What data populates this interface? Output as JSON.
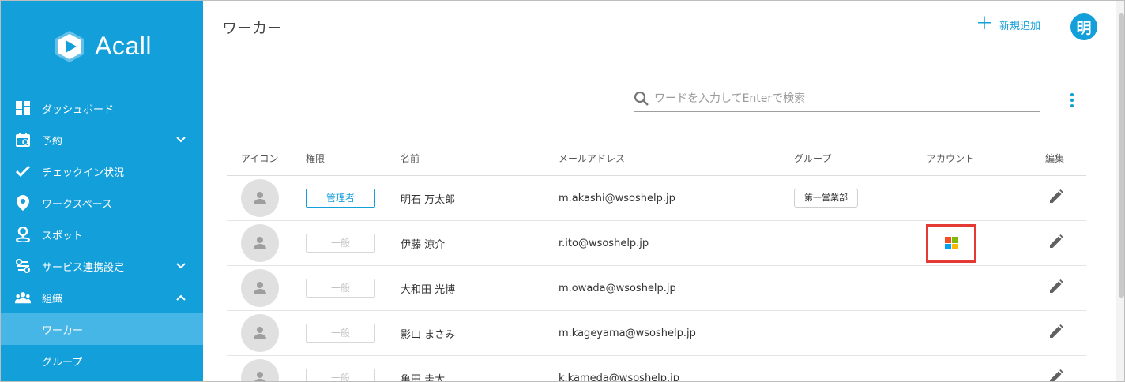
{
  "brand": {
    "name": "Acall"
  },
  "sidebar": {
    "items": [
      {
        "label": "ダッシュボード",
        "icon": "dashboard-icon"
      },
      {
        "label": "予約",
        "icon": "calendar-icon",
        "chevron": "chevron-down-icon"
      },
      {
        "label": "チェックイン状況",
        "icon": "check-icon"
      },
      {
        "label": "ワークスペース",
        "icon": "location-pin-icon"
      },
      {
        "label": "スポット",
        "icon": "person-pin-icon"
      },
      {
        "label": "サービス連携設定",
        "icon": "integration-icon",
        "chevron": "chevron-down-icon"
      },
      {
        "label": "組織",
        "icon": "people-icon",
        "chevron": "chevron-up-icon"
      }
    ],
    "sub_items": [
      {
        "label": "ワーカー",
        "active": true
      },
      {
        "label": "グループ",
        "active": false
      }
    ]
  },
  "header": {
    "title": "ワーカー",
    "add_label": "新規追加",
    "avatar_initial": "明"
  },
  "search": {
    "placeholder": "ワードを入力してEnterで検索",
    "value": ""
  },
  "table": {
    "columns": [
      "アイコン",
      "権限",
      "名前",
      "メールアドレス",
      "グループ",
      "アカウント",
      "編集"
    ],
    "rows": [
      {
        "role": "管理者",
        "admin": true,
        "name": "明石 万太郎",
        "email": "m.akashi@wsoshelp.jp",
        "group": "第一営業部",
        "account": ""
      },
      {
        "role": "一般",
        "admin": false,
        "name": "伊藤 涼介",
        "email": "r.ito@wsoshelp.jp",
        "group": "",
        "account": "microsoft"
      },
      {
        "role": "一般",
        "admin": false,
        "name": "大和田 光博",
        "email": "m.owada@wsoshelp.jp",
        "group": "",
        "account": ""
      },
      {
        "role": "一般",
        "admin": false,
        "name": "影山 まさみ",
        "email": "m.kageyama@wsoshelp.jp",
        "group": "",
        "account": ""
      },
      {
        "role": "一般",
        "admin": false,
        "name": "亀田 圭太",
        "email": "k.kameda@wsoshelp.jp",
        "group": "",
        "account": ""
      }
    ]
  },
  "colors": {
    "brand": "#139fda",
    "sidebar_active": "#46b6e6",
    "highlight": "#e53935"
  }
}
